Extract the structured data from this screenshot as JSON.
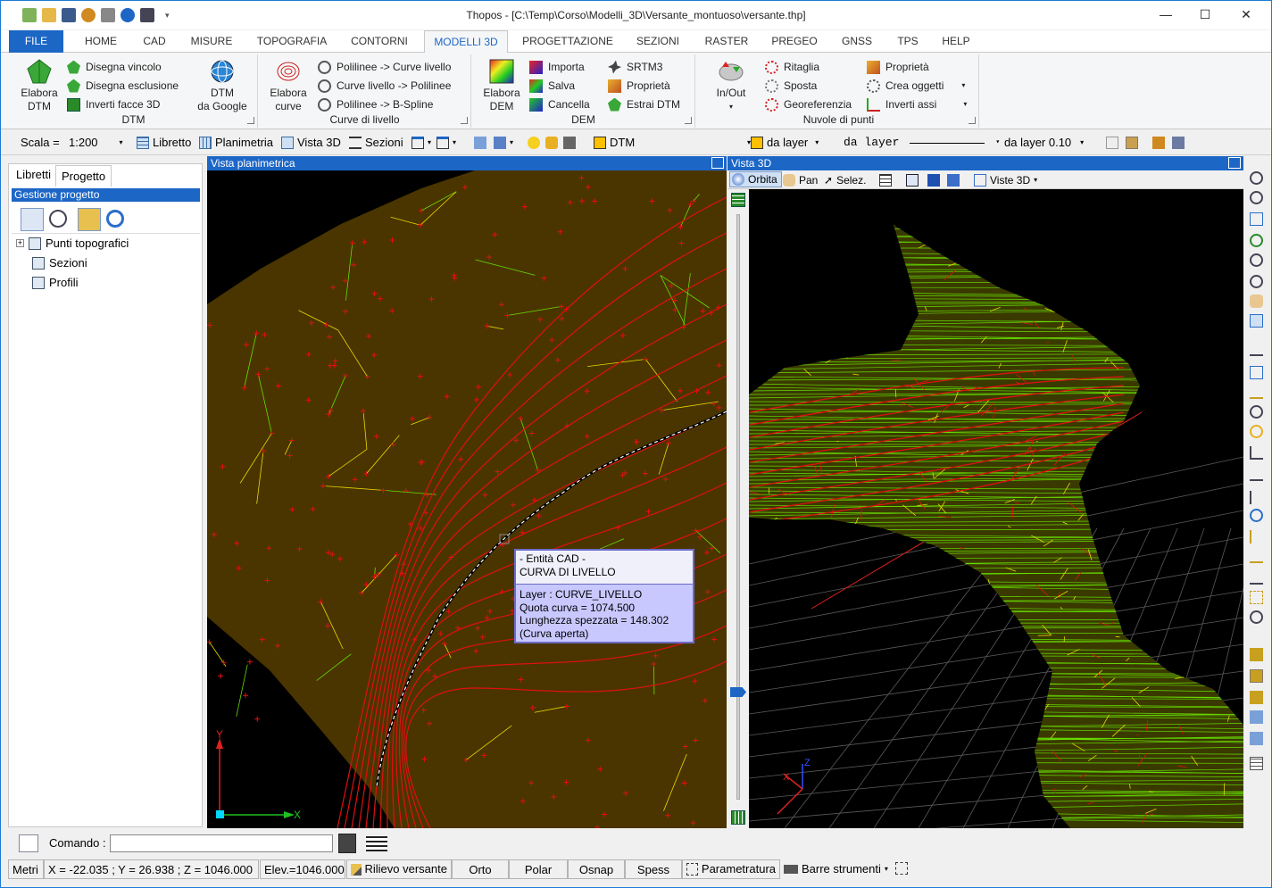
{
  "window": {
    "title": "Thopos - [C:\\Temp\\Corso\\Modelli_3D\\Versante_montuoso\\versante.thp]",
    "minimize": "—",
    "maximize": "☐",
    "close": "✕"
  },
  "menu": {
    "file": "FILE",
    "tabs": [
      "HOME",
      "CAD",
      "MISURE",
      "TOPOGRAFIA",
      "CONTORNI",
      "MODELLI 3D",
      "PROGETTAZIONE",
      "SEZIONI",
      "RASTER",
      "PREGEO",
      "GNSS",
      "TPS",
      "HELP"
    ],
    "active": "MODELLI 3D"
  },
  "ribbon": {
    "dtm": {
      "label": "DTM",
      "elabora": "Elabora\nDTM",
      "disegna_vincolo": "Disegna vincolo",
      "disegna_esclusione": "Disegna esclusione",
      "inverti_facce": "Inverti facce 3D",
      "dtm_google": "DTM\nda Google"
    },
    "curve": {
      "label": "Curve di livello",
      "elabora": "Elabora\ncurve",
      "pol_curve": "Polilinee -> Curve livello",
      "curve_pol": "Curve livello -> Polilinee",
      "pol_bspline": "Polilinee -> B-Spline"
    },
    "dem": {
      "label": "DEM",
      "elabora": "Elabora\nDEM",
      "importa": "Importa",
      "salva": "Salva",
      "cancella": "Cancella",
      "srtm3": "SRTM3",
      "proprieta": "Proprietà",
      "estrai": "Estrai DTM"
    },
    "nuvole": {
      "label": "Nuvole di punti",
      "inout": "In/Out",
      "ritaglia": "Ritaglia",
      "sposta": "Sposta",
      "georef": "Georeferenzia",
      "proprieta": "Proprietà",
      "crea": "Crea oggetti",
      "inverti": "Inverti assi"
    }
  },
  "toolbar": {
    "scala_label": "Scala =",
    "scala_value": "1:200",
    "libretto": "Libretto",
    "planimetria": "Planimetria",
    "vista3d": "Vista 3D",
    "sezioni": "Sezioni",
    "dtm": "DTM",
    "layer_color": "da layer",
    "linetype": "da layer",
    "lineweight": "da layer 0.10"
  },
  "left_panel": {
    "tab_libretti": "Libretti",
    "tab_progetto": "Progetto",
    "header": "Gestione progetto",
    "tree": [
      "Punti topografici",
      "Sezioni",
      "Profili"
    ]
  },
  "view2d": {
    "title": "Vista planimetrica",
    "axis_y": "Y",
    "axis_x": "X"
  },
  "view3d": {
    "title": "Vista 3D",
    "orbita": "Orbita",
    "pan": "Pan",
    "selez": "Selez.",
    "viste": "Viste 3D",
    "axis_z": "Z",
    "axis_x": "X"
  },
  "tooltip": {
    "line1": "- Entità CAD -",
    "line2": "CURVA DI LIVELLO",
    "layer": "Layer : CURVE_LIVELLO",
    "quota": "Quota curva = 1074.500",
    "lunghezza": "Lunghezza spezzata = 148.302",
    "tipo": "(Curva aperta)"
  },
  "command": {
    "label": "Comando :",
    "value": ""
  },
  "status": {
    "units": "Metri",
    "coords": "X = -22.035 ; Y = 26.938 ; Z = 1046.000",
    "elev": "Elev.=1046.000",
    "rilievo": "Rilievo versante",
    "orto": "Orto",
    "polar": "Polar",
    "osnap": "Osnap",
    "spess": "Spess",
    "param": "Parametratura",
    "barre": "Barre strumenti"
  },
  "colors": {
    "accent": "#1c66c6",
    "mesh_green": "#66dd00",
    "mesh_yellow": "#e8d800",
    "contour_red": "#e01010",
    "terrain_fill": "#4a3500"
  }
}
